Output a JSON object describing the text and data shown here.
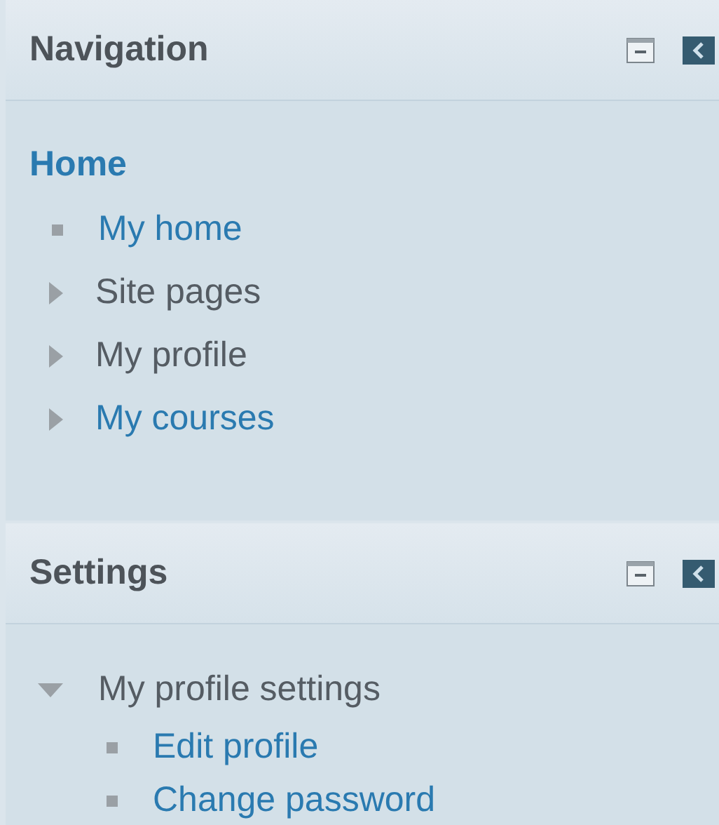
{
  "blocks": [
    {
      "title": "Navigation",
      "items": [
        {
          "label": "Home",
          "kind": "heading",
          "link": true
        },
        {
          "label": "My home",
          "kind": "leaf",
          "link": true
        },
        {
          "label": "Site pages",
          "kind": "branch",
          "expanded": false,
          "link": false
        },
        {
          "label": "My profile",
          "kind": "branch",
          "expanded": false,
          "link": false
        },
        {
          "label": "My courses",
          "kind": "branch",
          "expanded": false,
          "link": true
        }
      ]
    },
    {
      "title": "Settings",
      "items": [
        {
          "label": "My profile settings",
          "kind": "branch",
          "expanded": true,
          "link": false,
          "children": [
            {
              "label": "Edit profile",
              "kind": "leaf",
              "link": true
            },
            {
              "label": "Change password",
              "kind": "leaf",
              "link": true
            }
          ]
        }
      ]
    }
  ]
}
